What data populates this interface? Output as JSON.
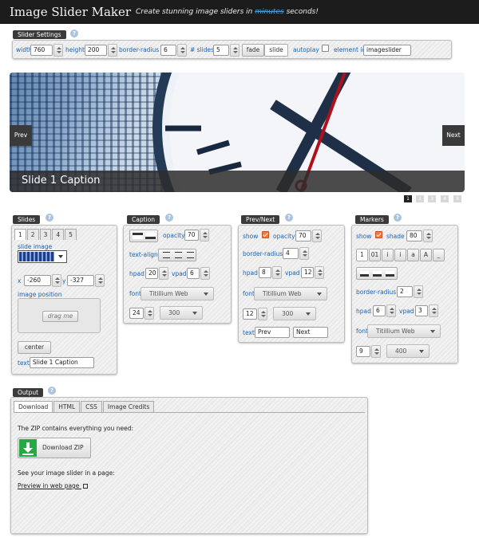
{
  "app": {
    "title": "Image Slider Maker",
    "tagline_start": "Create stunning image sliders in",
    "tagline_strike": "minutes",
    "tagline_end": "seconds!"
  },
  "settings": {
    "section": "Slider Settings",
    "width_label": "width",
    "width": "760",
    "height_label": "height",
    "height": "200",
    "radius_label": "border-radius",
    "radius": "6",
    "slides_label": "# slides",
    "slides": "5",
    "fade": "fade",
    "slide": "slide",
    "autoplay_label": "autoplay",
    "element_label": "element id",
    "element": "imageslider"
  },
  "preview": {
    "prev": "Prev",
    "next": "Next",
    "caption": "Slide 1 Caption",
    "markers": [
      "1",
      "2",
      "3",
      "4",
      "5"
    ]
  },
  "slides": {
    "section": "Slides",
    "tabs": [
      "1",
      "2",
      "3",
      "4",
      "5"
    ],
    "image_label": "slide image",
    "x_label": "x",
    "x": "-260",
    "y_label": "y",
    "y": "-327",
    "position_label": "image position",
    "drag": "drag me",
    "center": "center",
    "text_label": "text",
    "text": "Slide 1 Caption"
  },
  "caption": {
    "section": "Caption",
    "opacity_label": "opacity",
    "opacity": "70",
    "align_label": "text-align",
    "hpad_label": "hpad",
    "hpad": "20",
    "vpad_label": "vpad",
    "vpad": "6",
    "font_label": "font",
    "font": "Titillium Web",
    "size": "24",
    "weight": "300"
  },
  "prevnext": {
    "section": "Prev/Next",
    "show_label": "show",
    "opacity_label": "opacity",
    "opacity": "70",
    "radius_label": "border-radius",
    "radius": "4",
    "hpad_label": "hpad",
    "hpad": "8",
    "vpad_label": "vpad",
    "vpad": "12",
    "font_label": "font",
    "font": "Titillium Web",
    "size": "12",
    "weight": "300",
    "text_label": "text",
    "prev": "Prev",
    "next": "Next"
  },
  "markers": {
    "section": "Markers",
    "show_label": "show",
    "shade_label": "shade",
    "shade": "80",
    "styles": [
      "1",
      "01",
      "i",
      "i",
      "a",
      "A",
      "_"
    ],
    "radius_label": "border-radius",
    "radius": "2",
    "hpad_label": "hpad",
    "hpad": "6",
    "vpad_label": "vpad",
    "vpad": "3",
    "font_label": "font",
    "font": "Titillium Web",
    "size": "9",
    "weight": "400"
  },
  "output": {
    "section": "Output",
    "tabs": [
      "Download",
      "HTML",
      "CSS",
      "Image Credits"
    ],
    "zip_text": "The ZIP contains everything you need:",
    "download": "Download ZIP",
    "see_text": "See your image slider in a page:",
    "preview_link": "Preview in web page"
  },
  "help": "?"
}
